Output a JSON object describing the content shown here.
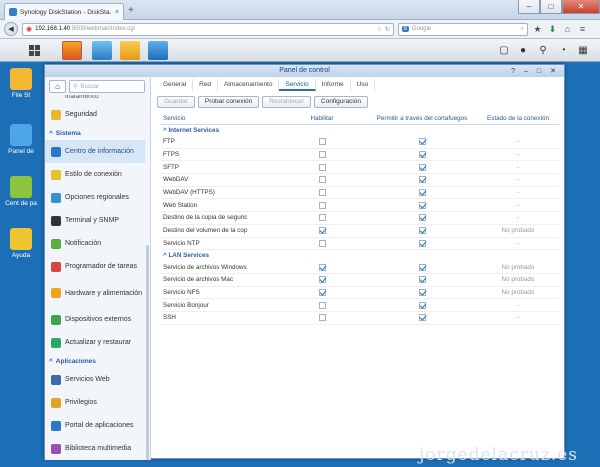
{
  "browser": {
    "tab_title": "Synology DiskStation - DiskSta...",
    "url_main": "192.168.1.40",
    "url_rest": ":5000/webman/index.cgi",
    "search_placeholder": "Google"
  },
  "desktop_icons": [
    "File St",
    "Panel de",
    "Cent de pa",
    "Ayuda"
  ],
  "window": {
    "title": "Panel de control"
  },
  "sidebar": {
    "search_placeholder": "Buscar",
    "truncated_top": "Inalámbrico",
    "items": [
      {
        "label": "Seguridad",
        "color": "#e8b52b"
      },
      {
        "section": "Sistema"
      },
      {
        "label": "Centro de información",
        "color": "#2b78c9",
        "active": true
      },
      {
        "label": "Estilo de conexión",
        "color": "#e6c12c"
      },
      {
        "label": "Opciones regionales",
        "color": "#3a8fd1"
      },
      {
        "label": "Terminal y SNMP",
        "color": "#333333"
      },
      {
        "label": "Notificación",
        "color": "#5ab03b"
      },
      {
        "label": "Programador de tareas",
        "color": "#d9453a"
      },
      {
        "label": "Hardware y alimentación",
        "color": "#f0a21e",
        "two": true
      },
      {
        "label": "Dispositivos externos",
        "color": "#3da447"
      },
      {
        "label": "Actualizar y restaurar",
        "color": "#2aa86a"
      },
      {
        "section": "Aplicaciones"
      },
      {
        "label": "Servicios Web",
        "color": "#3c6aa8"
      },
      {
        "label": "Privilegios",
        "color": "#e0a526"
      },
      {
        "label": "Portal de aplicaciones",
        "color": "#2b78c9"
      },
      {
        "label": "Biblioteca multimedia",
        "color": "#9b4fb3"
      }
    ]
  },
  "tabs": [
    {
      "label": "General"
    },
    {
      "label": "Red"
    },
    {
      "label": "Almacenamiento"
    },
    {
      "label": "Servicio",
      "active": true
    },
    {
      "label": "Informe"
    },
    {
      "label": "Uso"
    }
  ],
  "toolbar": {
    "save": "Guardar",
    "test": "Probar conexión",
    "reset": "Restablecer",
    "config": "Configuración"
  },
  "table": {
    "headers": [
      "Servicio",
      "Habilitar",
      "Permitir a través del cortafuegos",
      "Estado de la conexión"
    ],
    "groups": [
      {
        "name": "Internet Services",
        "rows": [
          {
            "service": "FTP",
            "enabled": false,
            "firewall": true,
            "status": "-"
          },
          {
            "service": "FTPS",
            "enabled": false,
            "firewall": true,
            "status": "-"
          },
          {
            "service": "SFTP",
            "enabled": false,
            "firewall": true,
            "status": "-"
          },
          {
            "service": "WebDAV",
            "enabled": false,
            "firewall": true,
            "status": "-"
          },
          {
            "service": "WebDAV (HTTPS)",
            "enabled": false,
            "firewall": true,
            "status": "-"
          },
          {
            "service": "Web Station",
            "enabled": false,
            "firewall": true,
            "status": "-"
          },
          {
            "service": "Destino de la copia de seguric",
            "enabled": false,
            "firewall": true,
            "status": "-"
          },
          {
            "service": "Destino del volumen de la cop",
            "enabled": true,
            "firewall": true,
            "status": "No probado"
          },
          {
            "service": "Servicio NTP",
            "enabled": false,
            "firewall": true,
            "status": "-"
          }
        ]
      },
      {
        "name": "LAN Services",
        "rows": [
          {
            "service": "Servicio de archivos Windows",
            "enabled": true,
            "firewall": true,
            "status": "No probado"
          },
          {
            "service": "Servicio de archivos Mac",
            "enabled": true,
            "firewall": true,
            "status": "No probado"
          },
          {
            "service": "Servicio NFS",
            "enabled": true,
            "firewall": true,
            "status": "No probado"
          },
          {
            "service": "Servicio Bonjour",
            "enabled": false,
            "firewall": true,
            "status": "-"
          },
          {
            "service": "SSH",
            "enabled": false,
            "firewall": true,
            "status": "-"
          }
        ]
      }
    ]
  },
  "watermark": "jorgedelacruz.es"
}
